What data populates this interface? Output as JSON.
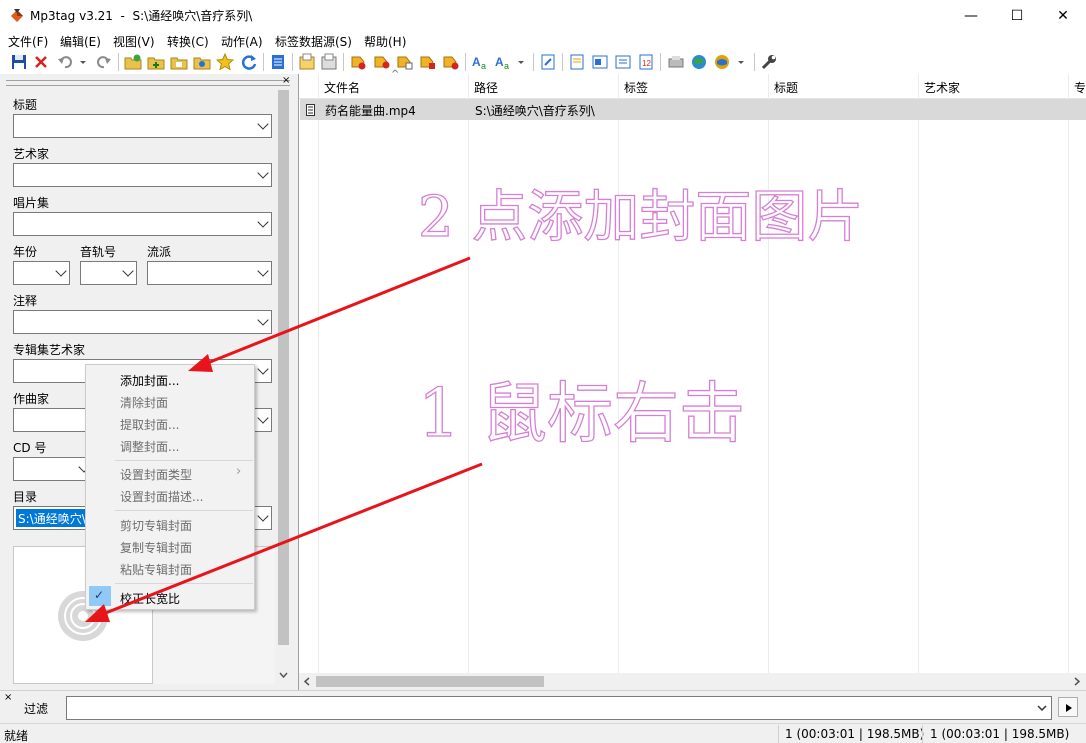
{
  "window": {
    "title": "Mp3tag v3.21  -  S:\\通经唤穴\\音疗系列\\",
    "minimize_glyph": "—",
    "maximize_glyph": "☐",
    "close_glyph": "✕"
  },
  "menu": [
    "文件(F)",
    "编辑(E)",
    "视图(V)",
    "转换(C)",
    "动作(A)",
    "标签数据源(S)",
    "帮助(H)"
  ],
  "toolbar_icons": [
    "save-icon",
    "delete-icon",
    "undo-icon",
    "undo-dropdown-icon",
    "redo-icon",
    "change-directory-icon",
    "add-directory-icon",
    "open-folder-icon",
    "favorites-folder-icon",
    "favorite-star-icon",
    "refresh-icon",
    "tag-panel-icon",
    "copy-tag-icon",
    "paste-tag-icon",
    "tag-to-filename-icon",
    "filename-to-tag-icon",
    "text-to-tag-icon",
    "tag-to-text-icon",
    "tag-to-tag-icon",
    "autonumber-icon",
    "case-convert-icon",
    "case-dropdown-icon",
    "export-icon",
    "playlist-icon",
    "tag-editor-icon",
    "extended-tags-icon",
    "numbering-icon",
    "web-source-icon",
    "web-source-2-icon",
    "web-source-3-icon",
    "web-source-dropdown-icon",
    "options-wrench-icon"
  ],
  "left_panel": {
    "close_glyph": "×",
    "fields": {
      "title": "标题",
      "artist": "艺术家",
      "album": "唱片集",
      "year": "年份",
      "track": "音轨号",
      "genre": "流派",
      "comment": "注释",
      "album_artist": "专辑集艺术家",
      "composer": "作曲家",
      "disc": "CD 号",
      "directory": "目录"
    },
    "directory_value": "S:\\通经唤穴\\"
  },
  "list": {
    "sort_glyph": "^",
    "columns": [
      "文件名",
      "路径",
      "标签",
      "标题",
      "艺术家",
      "专"
    ],
    "rows": [
      {
        "filename": "药名能量曲.mp4",
        "path": "S:\\通经唤穴\\音疗系列\\",
        "tag": "",
        "title": "",
        "artist": ""
      }
    ]
  },
  "context_menu": {
    "items": [
      {
        "label": "添加封面...",
        "enabled": true
      },
      {
        "label": "清除封面",
        "enabled": false
      },
      {
        "label": "提取封面...",
        "enabled": false
      },
      {
        "label": "调整封面...",
        "enabled": false
      },
      {
        "label": "设置封面类型",
        "enabled": false,
        "submenu": true
      },
      {
        "label": "设置封面描述...",
        "enabled": false
      },
      {
        "label": "剪切专辑封面",
        "enabled": false
      },
      {
        "label": "复制专辑封面",
        "enabled": false
      },
      {
        "label": "粘贴专辑封面",
        "enabled": false
      },
      {
        "label": "校正长宽比",
        "enabled": true,
        "checked": true
      }
    ],
    "submenu_glyph": "›",
    "check_glyph": "✓"
  },
  "filter": {
    "close_glyph": "×",
    "label": "过滤",
    "value": ""
  },
  "status": {
    "ready": "就绪",
    "selected": "1 (00:03:01 | 198.5MB)",
    "total": "1 (00:03:01 | 198.5MB)"
  },
  "annotations": {
    "step2": "2 点添加封面图片",
    "step1": "1 鼠标右击",
    "color": "#d67fd6",
    "arrow_color": "#e8141c"
  }
}
